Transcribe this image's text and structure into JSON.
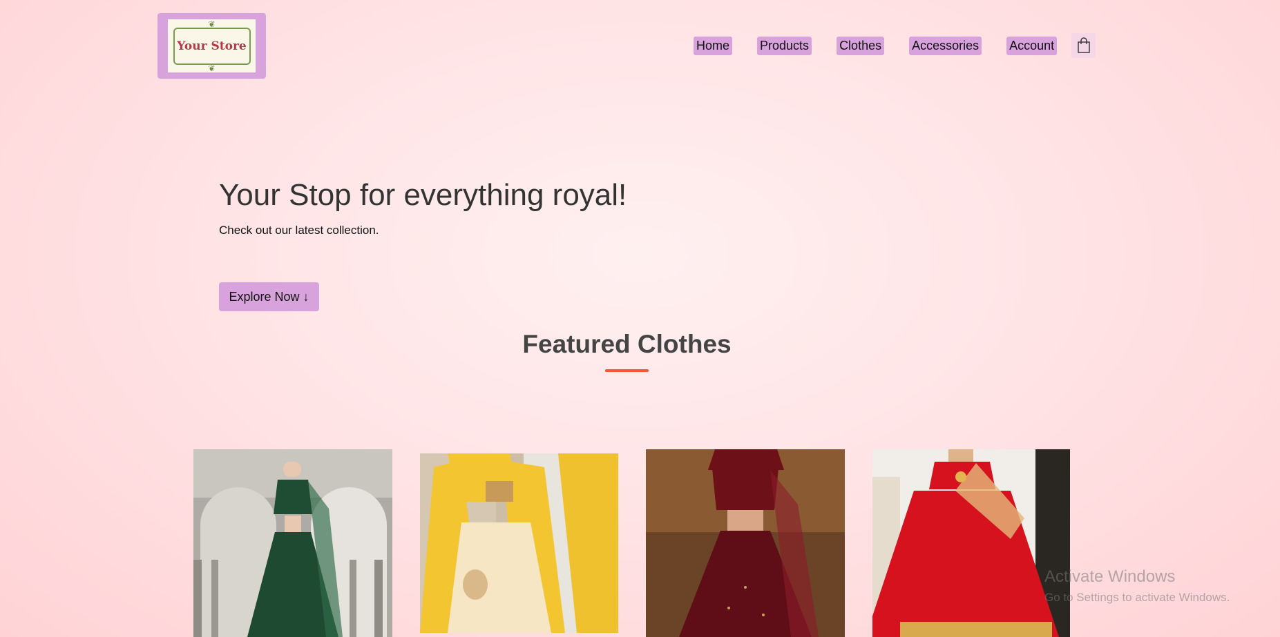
{
  "header": {
    "logo_text": "Your Store",
    "nav": [
      "Home",
      "Products",
      "Clothes",
      "Accessories",
      "Account"
    ]
  },
  "hero": {
    "title": "Your Stop for everything royal!",
    "subtitle": "Check out our latest collection.",
    "cta_label": "Explore Now ↓"
  },
  "featured": {
    "title": "Featured Clothes",
    "products": [
      {
        "name": "green-lehenga",
        "dress": "#1f4d34",
        "bg": "#a9a7a2"
      },
      {
        "name": "yellow-lehenga",
        "dress": "#f2c531",
        "bg": "#d9c9b2"
      },
      {
        "name": "maroon-lehenga",
        "dress": "#6e1018",
        "bg": "#7a4e2c"
      },
      {
        "name": "red-lehenga",
        "dress": "#d6121e",
        "bg": "#efeae4"
      }
    ]
  },
  "watermark": {
    "title": "Activate Windows",
    "subtitle": "Go to Settings to activate Windows."
  },
  "colors": {
    "accent": "#d8a2dc",
    "underline": "#ff523b",
    "background": "#ffe4e6"
  }
}
